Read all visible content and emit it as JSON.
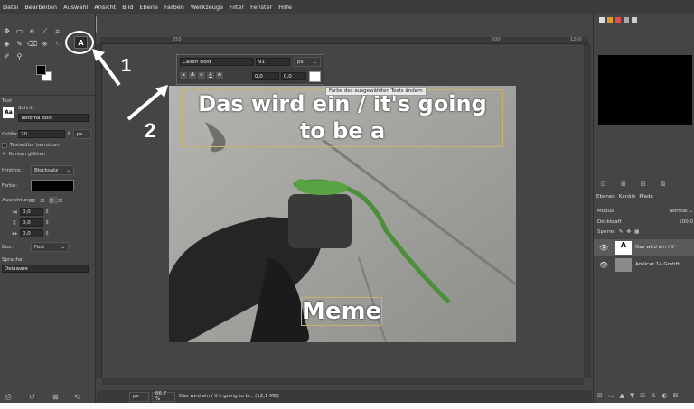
{
  "menu": [
    "Datei",
    "Bearbeiten",
    "Auswahl",
    "Ansicht",
    "Bild",
    "Ebene",
    "Farben",
    "Werkzeuge",
    "Filter",
    "Fenster",
    "Hilfe"
  ],
  "toolbox": {
    "panel_title": "Text",
    "font_label": "Schrift",
    "font_value": "Tahoma Bold",
    "size_label": "Größe:",
    "size_value": "70",
    "size_unit": "px",
    "use_editor_label": "Texteditor benutzen",
    "antialias_label": "Kanten glätten",
    "hinting_label": "Hinting:",
    "hinting_value": "Blocksatz",
    "color_label": "Farbe:",
    "justify_label": "Ausrichtung:",
    "indent_value": "0,0",
    "line_spacing_value": "0,0",
    "letter_spacing_value": "0,0",
    "box_label": "Box:",
    "box_value": "Fest",
    "language_label": "Sprache:",
    "language_value": "Delaware",
    "text_tool_glyph": "A"
  },
  "ruler": {
    "mark_250": "250",
    "mark_500": "500",
    "mark_1250": "1250"
  },
  "text_editor_overlay": {
    "font": "Calibri Bold",
    "size": "91",
    "unit": "px",
    "baseline": "0,0",
    "kerning": "0,0",
    "tooltip": "Farbe des ausgewählten Texts ändern"
  },
  "image": {
    "top_text": "Das wird ein / it's going to be a",
    "bottom_text": "Meme"
  },
  "annotations": {
    "one": "1",
    "two": "2"
  },
  "layers": {
    "tabs": [
      "Ebenen",
      "Kanäle",
      "Pfade"
    ],
    "mode_label": "Modus",
    "mode_value": "Normal",
    "opacity_label": "Deckkraft",
    "opacity_value": "100,0",
    "lock_label": "Sperre:",
    "items": [
      {
        "name": "Das wird ein / it'"
      },
      {
        "name": "Amilcar 14 GmbH."
      }
    ]
  },
  "status": {
    "unit": "px",
    "zoom": "66,7 %",
    "message": "Das wird ein / it's going to b... (12,1 MB)"
  }
}
